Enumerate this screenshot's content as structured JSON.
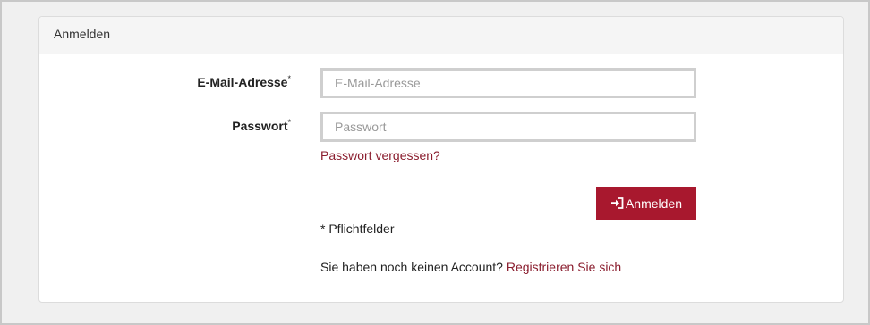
{
  "panel": {
    "title": "Anmelden"
  },
  "form": {
    "email_label": "E-Mail-Adresse",
    "email_required_mark": "*",
    "email_placeholder": "E-Mail-Adresse",
    "email_value": "",
    "password_label": "Passwort",
    "password_required_mark": "*",
    "password_placeholder": "Passwort",
    "password_value": "",
    "forgot_link": "Passwort vergessen?",
    "login_button": "Anmelden",
    "required_note": "* Pflichtfelder",
    "register_prompt": "Sie haben noch keinen Account?",
    "register_link": "Registrieren Sie sich"
  },
  "colors": {
    "accent": "#a8182e",
    "link": "#8a1d2e"
  },
  "icons": {
    "login_icon": "sign-in-icon"
  }
}
